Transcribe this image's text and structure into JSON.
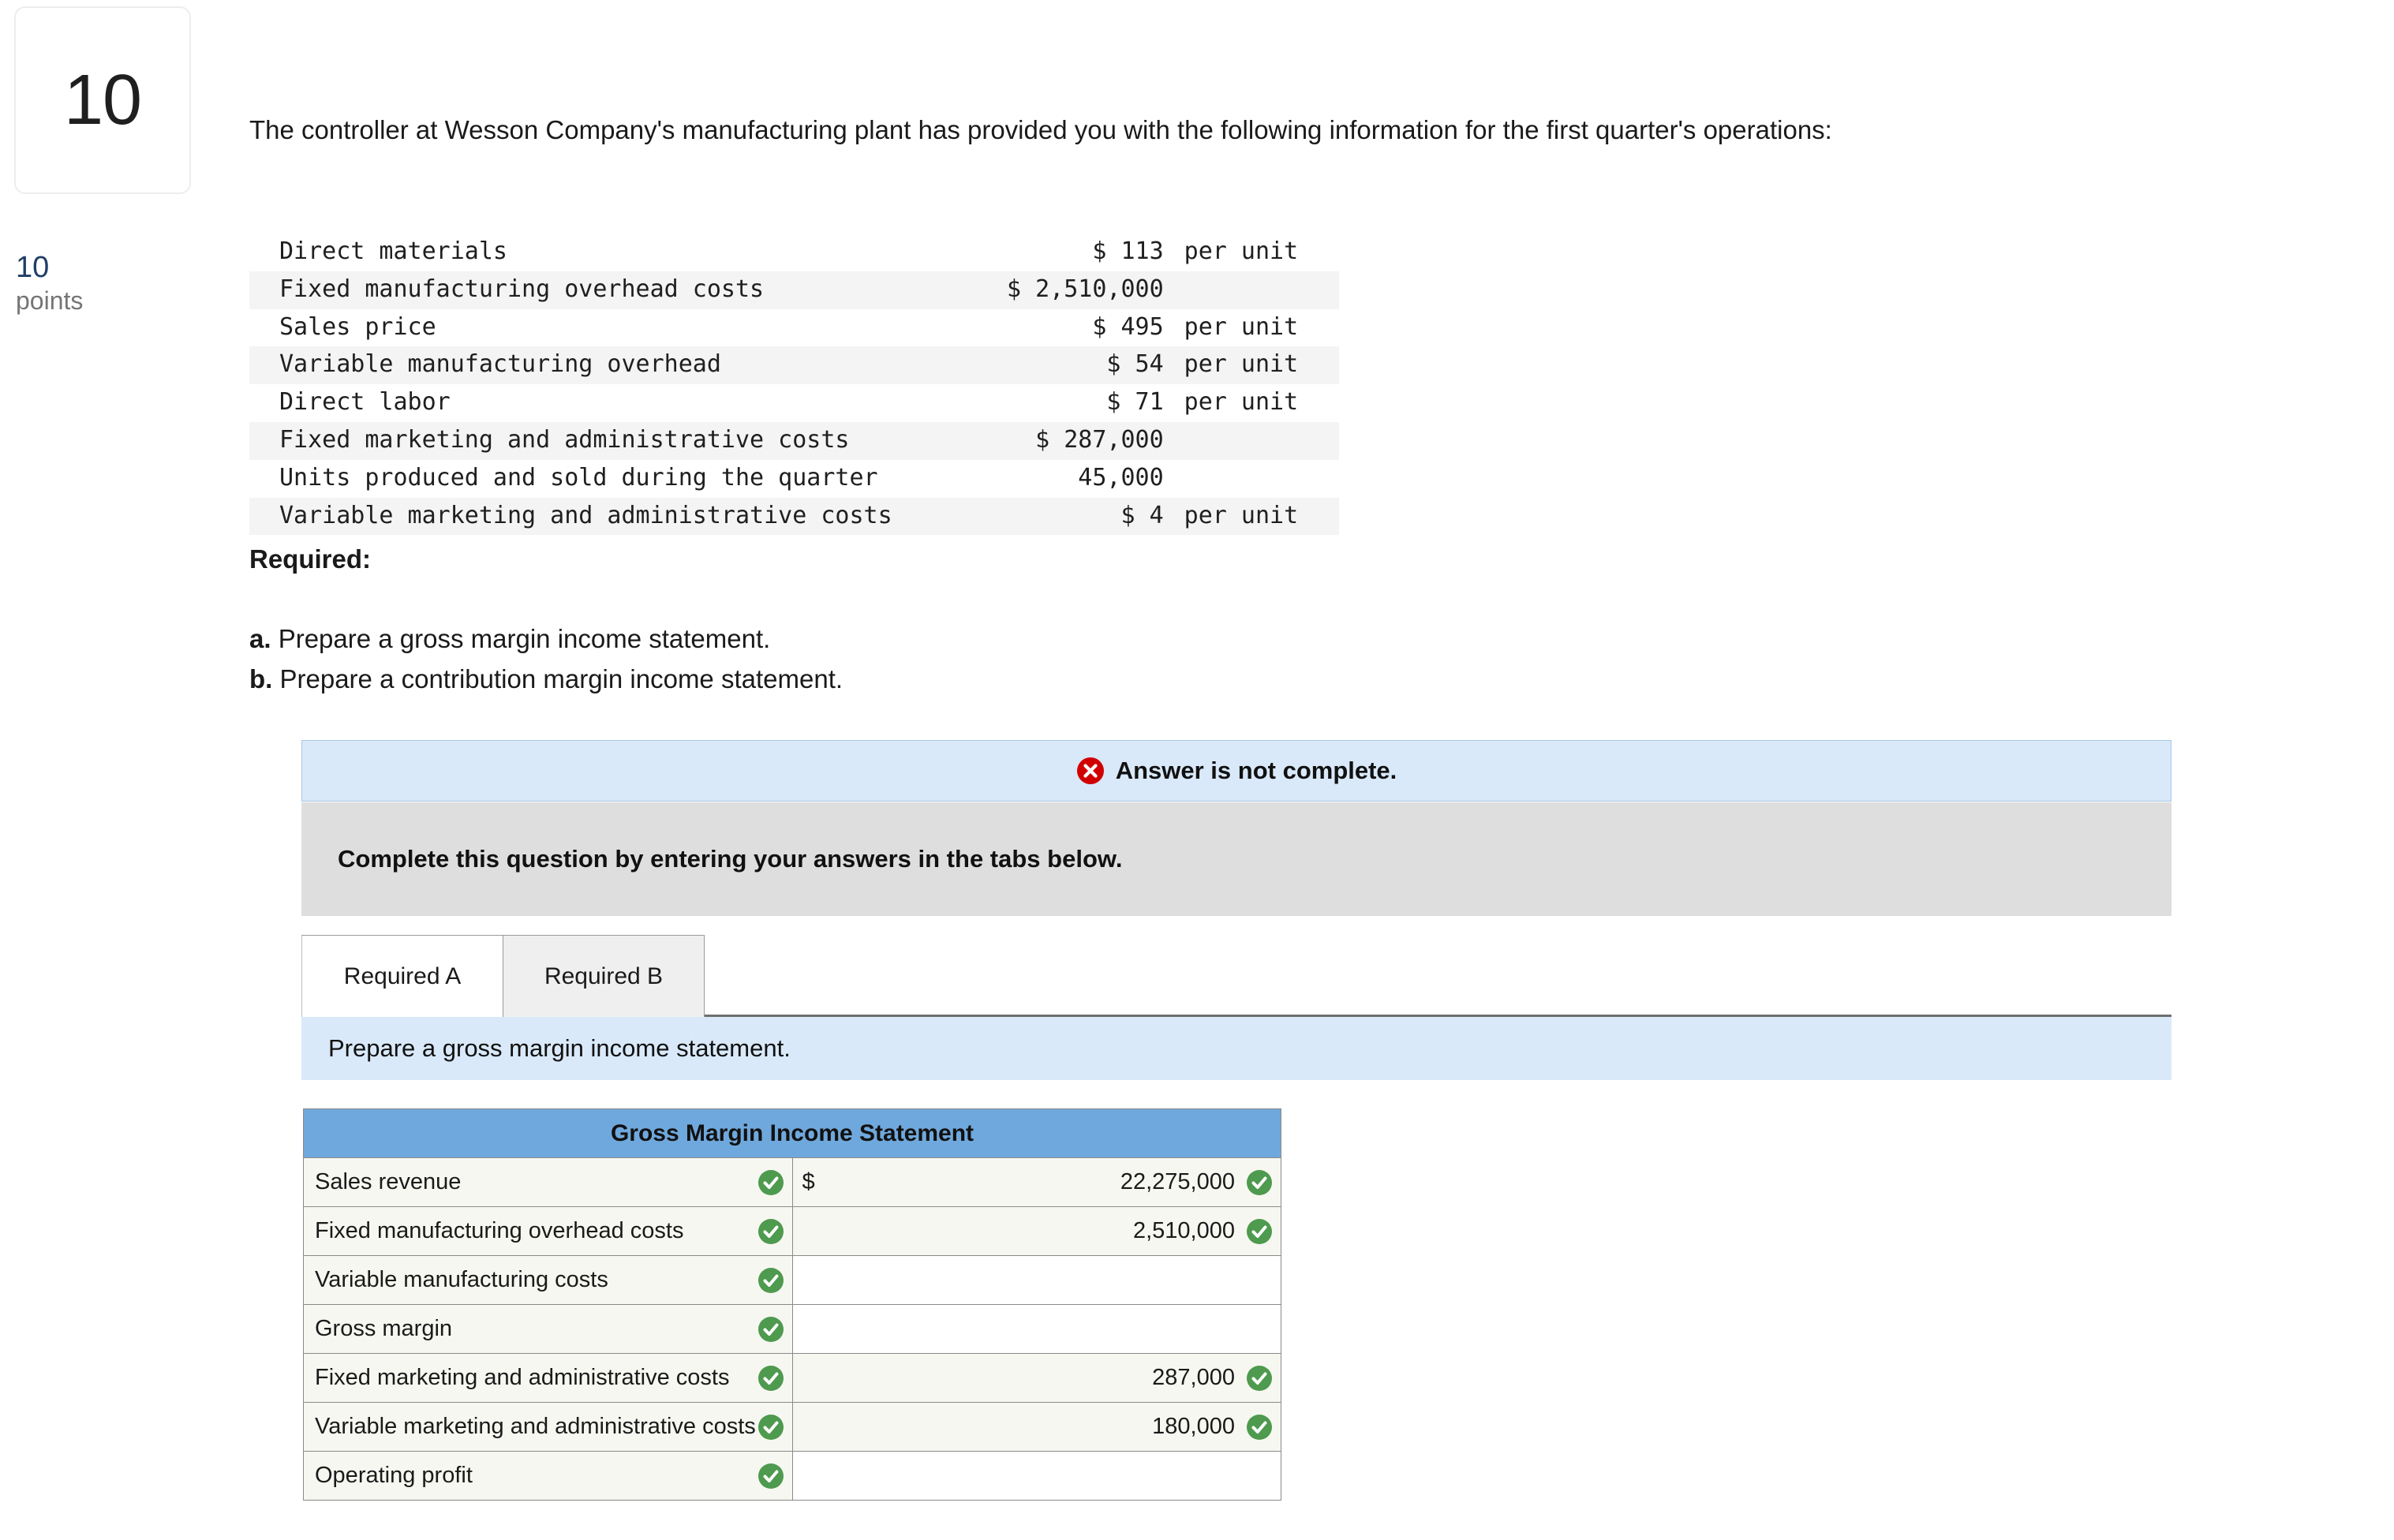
{
  "question": {
    "number": "10",
    "points_value": "10",
    "points_label": "points",
    "stem": "The controller at Wesson Company's manufacturing plant has provided you with the following information for the first quarter's operations:"
  },
  "given_data": {
    "rows": [
      {
        "label": "Direct materials",
        "amount": "$ 113",
        "unit": "per unit"
      },
      {
        "label": "Fixed manufacturing overhead costs",
        "amount": "$ 2,510,000",
        "unit": ""
      },
      {
        "label": "Sales price",
        "amount": "$ 495",
        "unit": "per unit"
      },
      {
        "label": "Variable manufacturing overhead",
        "amount": "$ 54",
        "unit": "per unit"
      },
      {
        "label": "Direct labor",
        "amount": "$ 71",
        "unit": "per unit"
      },
      {
        "label": "Fixed marketing and administrative costs",
        "amount": "$ 287,000",
        "unit": ""
      },
      {
        "label": "Units produced and sold during the quarter",
        "amount": "45,000",
        "unit": ""
      },
      {
        "label": "Variable marketing and administrative costs",
        "amount": "$ 4",
        "unit": "per unit"
      }
    ]
  },
  "required": {
    "heading": "Required:",
    "items": [
      {
        "marker": "a.",
        "text": "Prepare a gross margin income statement."
      },
      {
        "marker": "b.",
        "text": "Prepare a contribution margin income statement."
      }
    ]
  },
  "answer_panel": {
    "status_banner": {
      "icon": "error-circle-x-icon",
      "text": "Answer is not complete.",
      "icon_color": "#d10000",
      "background": "#d9e9f9"
    },
    "instruction": "Complete this question by entering your answers in the tabs below.",
    "tabs": [
      {
        "label": "Required A",
        "active": true
      },
      {
        "label": "Required B",
        "active": false
      }
    ],
    "subprompt": "Prepare a gross margin income statement."
  },
  "statement_table": {
    "title": "Gross Margin Income Statement",
    "header_color": "#6fa8dc",
    "check_color": "#4e9a4e",
    "rows": [
      {
        "label": "Sales revenue",
        "label_ok": true,
        "currency": "$",
        "amount": "22,275,000",
        "value_ok": true
      },
      {
        "label": "Fixed manufacturing overhead costs",
        "label_ok": true,
        "currency": "",
        "amount": "2,510,000",
        "value_ok": true
      },
      {
        "label": "Variable manufacturing costs",
        "label_ok": true,
        "currency": "",
        "amount": "",
        "value_ok": false
      },
      {
        "label": "Gross margin",
        "label_ok": true,
        "currency": "",
        "amount": "",
        "value_ok": false
      },
      {
        "label": "Fixed marketing and administrative costs",
        "label_ok": true,
        "currency": "",
        "amount": "287,000",
        "value_ok": true
      },
      {
        "label": "Variable marketing and administrative costs",
        "label_ok": true,
        "currency": "",
        "amount": "180,000",
        "value_ok": true
      },
      {
        "label": "Operating profit",
        "label_ok": true,
        "currency": "",
        "amount": "",
        "value_ok": false
      }
    ]
  }
}
